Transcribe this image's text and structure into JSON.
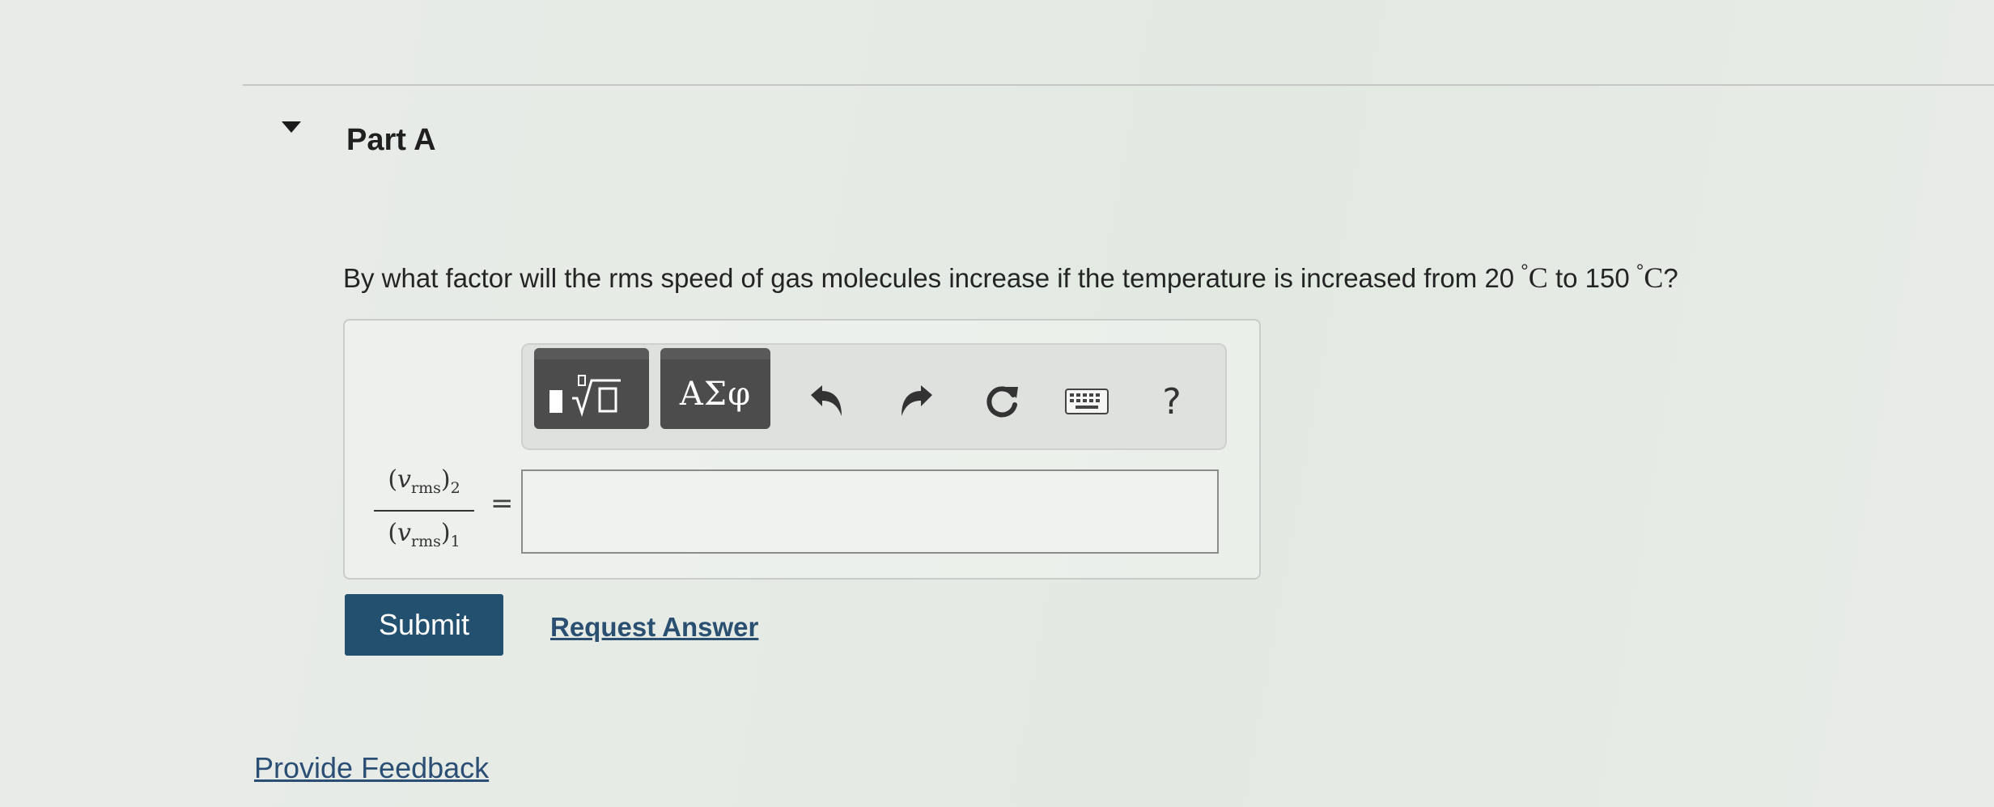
{
  "part": {
    "title": "Part A",
    "collapse_icon": "caret-down-icon"
  },
  "question": {
    "prefix": "By what factor will the rms speed of gas molecules increase if the temperature is increased from 20",
    "temp1_unit": "C",
    "middle": "to 150",
    "temp2_unit": "C",
    "suffix": "?",
    "degree_symbol": "°"
  },
  "toolbar": {
    "templates_icon": "templates-icon",
    "greek_label": "ΑΣφ",
    "undo_icon": "undo-icon",
    "redo_icon": "redo-icon",
    "reset_icon": "reset-icon",
    "keyboard_icon": "keyboard-icon",
    "help_label": "?"
  },
  "answer": {
    "numerator": {
      "var": "v",
      "sub": "rms",
      "index": "2"
    },
    "denominator": {
      "var": "v",
      "sub": "rms",
      "index": "1"
    },
    "equals": "=",
    "value": "",
    "placeholder": ""
  },
  "actions": {
    "submit_label": "Submit",
    "request_answer_label": "Request Answer"
  },
  "footer": {
    "feedback_label": "Provide Feedback"
  },
  "colors": {
    "submit_bg": "#24506f",
    "link": "#2a4f71",
    "toolbar_button": "#4c4c4c"
  }
}
